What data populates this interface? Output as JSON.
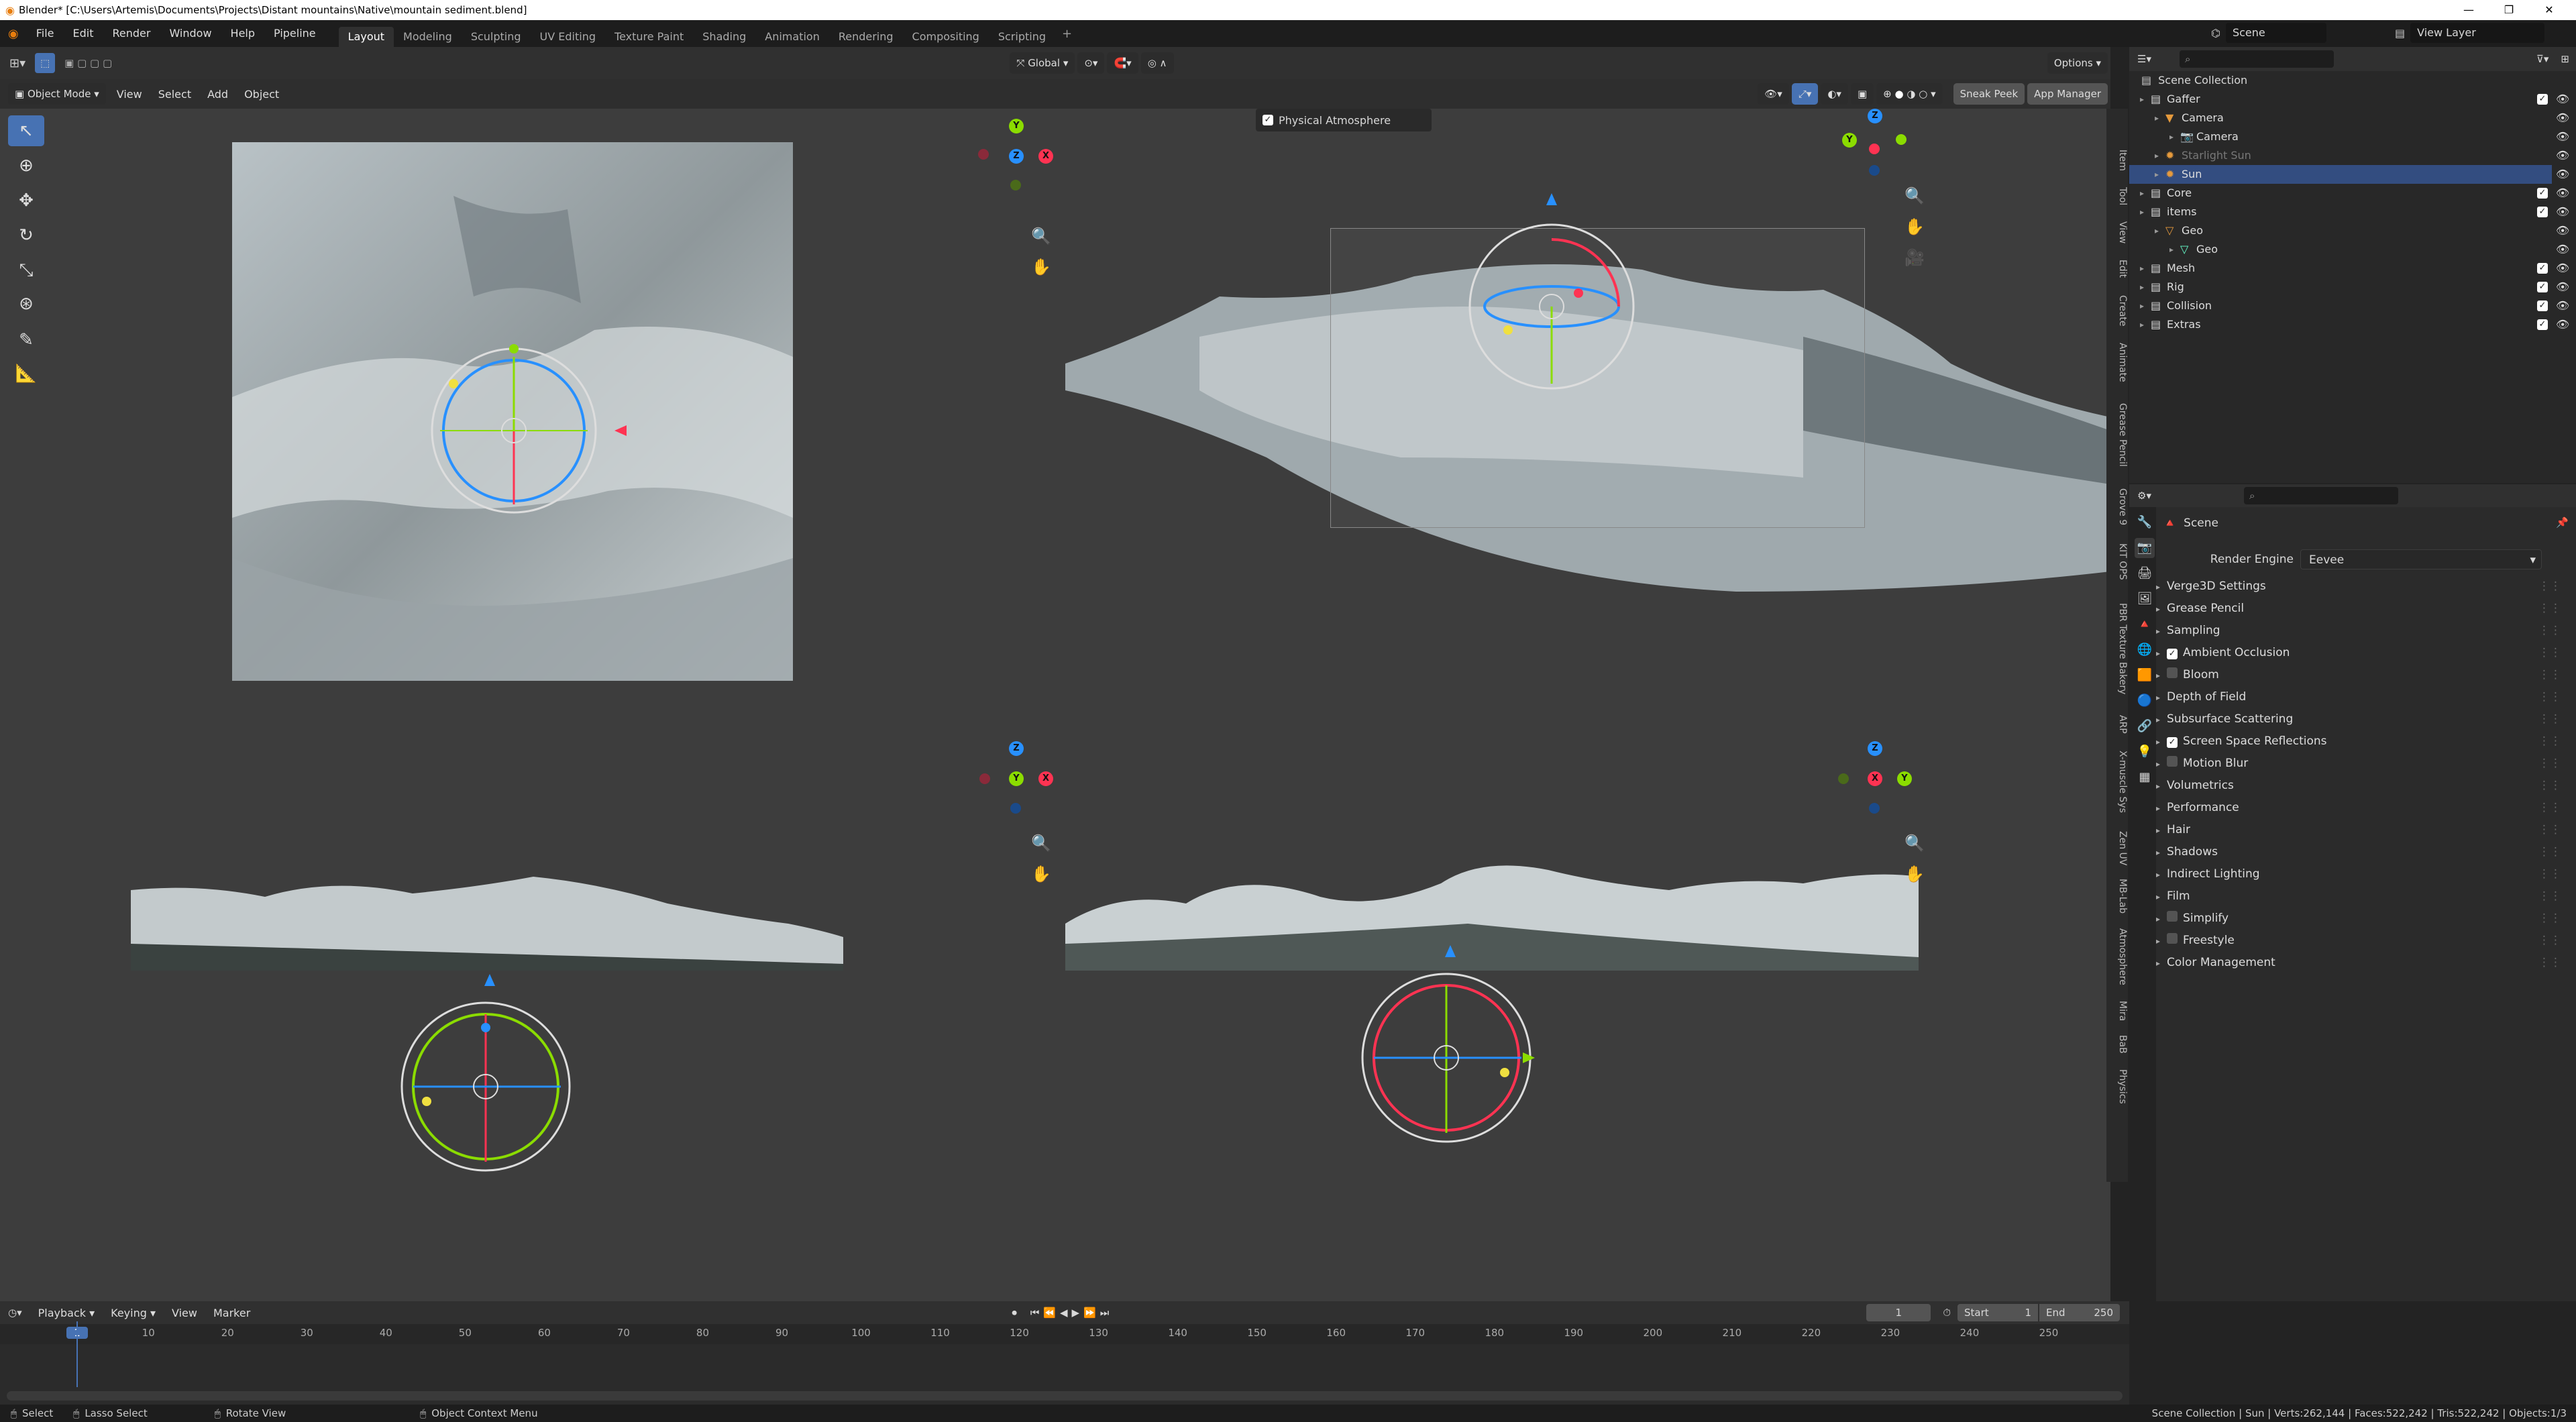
{
  "window": {
    "title": "Blender* [C:\\Users\\Artemis\\Documents\\Projects\\Distant mountains\\Native\\mountain sediment.blend]"
  },
  "menu": [
    "File",
    "Edit",
    "Render",
    "Window",
    "Help",
    "Pipeline"
  ],
  "workspaces": [
    "Layout",
    "Modeling",
    "Sculpting",
    "UV Editing",
    "Texture Paint",
    "Shading",
    "Animation",
    "Rendering",
    "Compositing",
    "Scripting"
  ],
  "active_workspace": "Layout",
  "topbar_right": {
    "scene_label": "Scene",
    "view_layer_label": "View Layer"
  },
  "viewport_header": {
    "mode": "Object Mode",
    "view": "View",
    "select": "Select",
    "add": "Add",
    "object": "Object",
    "orientation": "Global",
    "options": "Options",
    "sneak_peek": "Sneak Peek",
    "app_manager": "App Manager"
  },
  "panel_popup": {
    "label": "Physical Atmosphere",
    "checked": true
  },
  "gizmo_letters": {
    "x": "X",
    "y": "Y",
    "z": "Z"
  },
  "sidebar_tabs": [
    "Item",
    "Tool",
    "View",
    "Edit",
    "Create",
    "Animate",
    "Grease Pencil",
    "Grove 9",
    "KIT OPS",
    "PBR Texture Bakery",
    "ARP",
    "X-muscle Sys",
    "Zen UV",
    "MB-Lab",
    "Atmosphere",
    "Mira",
    "BaB",
    "Physics"
  ],
  "outliner": {
    "root": "Scene Collection",
    "rows": [
      {
        "label": "Gaffer",
        "indent": 1,
        "icon": "collection-icon",
        "check": true,
        "selected": false,
        "dim": false
      },
      {
        "label": "Camera",
        "indent": 2,
        "icon": "camera-object-icon",
        "check": false,
        "selected": false,
        "dim": false
      },
      {
        "label": "Camera",
        "indent": 3,
        "icon": "camera-data-icon",
        "check": false,
        "selected": false,
        "dim": false
      },
      {
        "label": "Starlight Sun",
        "indent": 2,
        "icon": "light-icon",
        "check": false,
        "selected": false,
        "dim": true
      },
      {
        "label": "Sun",
        "indent": 2,
        "icon": "light-icon",
        "check": false,
        "selected": true,
        "dim": false
      },
      {
        "label": "Core",
        "indent": 1,
        "icon": "collection-icon",
        "check": true,
        "selected": false,
        "dim": false
      },
      {
        "label": "items",
        "indent": 1,
        "icon": "collection-icon",
        "check": true,
        "selected": false,
        "dim": false
      },
      {
        "label": "Geo",
        "indent": 2,
        "icon": "mesh-object-icon",
        "check": false,
        "selected": false,
        "dim": false
      },
      {
        "label": "Geo",
        "indent": 3,
        "icon": "mesh-data-icon",
        "check": false,
        "selected": false,
        "dim": false
      },
      {
        "label": "Mesh",
        "indent": 1,
        "icon": "collection-icon",
        "check": true,
        "selected": false,
        "dim": false
      },
      {
        "label": "Rig",
        "indent": 1,
        "icon": "collection-icon",
        "check": true,
        "selected": false,
        "dim": false
      },
      {
        "label": "Collision",
        "indent": 1,
        "icon": "collection-icon",
        "check": true,
        "selected": false,
        "dim": false
      },
      {
        "label": "Extras",
        "indent": 1,
        "icon": "collection-icon",
        "check": true,
        "selected": false,
        "dim": false
      }
    ]
  },
  "properties": {
    "context": "Scene",
    "render_engine_label": "Render Engine",
    "render_engine": "Eevee",
    "panels": [
      {
        "label": "Verge3D Settings",
        "checkbox": null
      },
      {
        "label": "Grease Pencil",
        "checkbox": null
      },
      {
        "label": "Sampling",
        "checkbox": null
      },
      {
        "label": "Ambient Occlusion",
        "checkbox": true
      },
      {
        "label": "Bloom",
        "checkbox": false
      },
      {
        "label": "Depth of Field",
        "checkbox": null
      },
      {
        "label": "Subsurface Scattering",
        "checkbox": null
      },
      {
        "label": "Screen Space Reflections",
        "checkbox": true
      },
      {
        "label": "Motion Blur",
        "checkbox": false
      },
      {
        "label": "Volumetrics",
        "checkbox": null
      },
      {
        "label": "Performance",
        "checkbox": null
      },
      {
        "label": "Hair",
        "checkbox": null
      },
      {
        "label": "Shadows",
        "checkbox": null
      },
      {
        "label": "Indirect Lighting",
        "checkbox": null
      },
      {
        "label": "Film",
        "checkbox": null
      },
      {
        "label": "Simplify",
        "checkbox": false
      },
      {
        "label": "Freestyle",
        "checkbox": false
      },
      {
        "label": "Color Management",
        "checkbox": null
      }
    ]
  },
  "timeline": {
    "playback": "Playback",
    "keying": "Keying",
    "view": "View",
    "marker": "Marker",
    "current_frame": "1",
    "start_label": "Start",
    "start": "1",
    "end_label": "End",
    "end": "250",
    "ruler": [
      "1",
      "10",
      "20",
      "30",
      "40",
      "50",
      "60",
      "70",
      "80",
      "90",
      "100",
      "110",
      "120",
      "130",
      "140",
      "150",
      "160",
      "170",
      "180",
      "190",
      "200",
      "210",
      "220",
      "230",
      "240",
      "250"
    ],
    "playhead": "1"
  },
  "statusbar": {
    "select": "Select",
    "lasso": "Lasso Select",
    "rotate": "Rotate View",
    "context_menu": "Object Context Menu",
    "stats": "Scene Collection | Sun | Verts:262,144 | Faces:522,242 | Tris:522,242 | Objects:1/3"
  },
  "colors": {
    "x_axis": "#ff3352",
    "y_axis": "#8bdc00",
    "z_axis": "#2890ff",
    "selection": "#334d80",
    "accent": "#4772b3"
  }
}
